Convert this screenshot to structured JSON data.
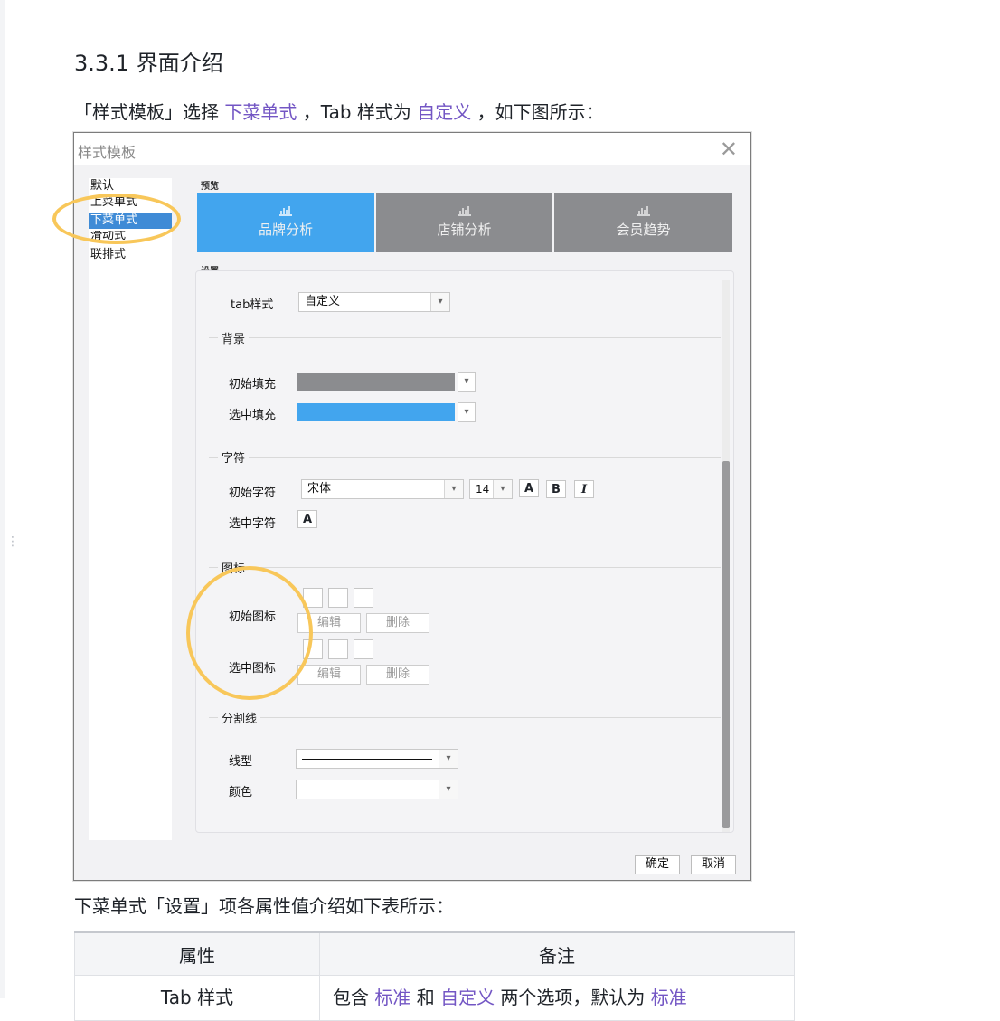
{
  "heading": "3.3.1 界面介绍",
  "intro": {
    "prefix": "「样式模板」选择 ",
    "link1": "下菜单式",
    "middle": " ，Tab 样式为 ",
    "link2": "自定义",
    "suffix": " ，如下图所示："
  },
  "dialog": {
    "title": "样式模板",
    "style_list": [
      "默认",
      "上菜单式",
      "下菜单式",
      "滑动式",
      "联排式"
    ],
    "selected_style": "下菜单式",
    "preview_label": "预览",
    "preview_tabs": [
      {
        "label": "品牌分析",
        "active": true
      },
      {
        "label": "店铺分析",
        "active": false
      },
      {
        "label": "会员趋势",
        "active": false
      }
    ],
    "settings_label": "设置",
    "tab_style": {
      "label": "tab样式",
      "value": "自定义"
    },
    "background": {
      "title": "背景",
      "initial_fill": {
        "label": "初始填充",
        "color": "#8b8c8f"
      },
      "selected_fill": {
        "label": "选中填充",
        "color": "#42a5ee"
      }
    },
    "chars": {
      "title": "字符",
      "initial": {
        "label": "初始字符",
        "font": "宋体",
        "size": "14",
        "btn_a": "A",
        "btn_b": "B",
        "btn_i": "I"
      },
      "selected": {
        "label": "选中字符",
        "btn_a": "A"
      }
    },
    "icons": {
      "title": "图标",
      "initial": {
        "label": "初始图标",
        "edit": "编辑",
        "delete": "删除"
      },
      "selected": {
        "label": "选中图标",
        "edit": "编辑",
        "delete": "删除"
      }
    },
    "divider": {
      "title": "分割线",
      "line_type_label": "线型",
      "color_label": "颜色"
    },
    "ok": "确定",
    "cancel": "取消"
  },
  "table_intro": "下菜单式「设置」项各属性值介绍如下表所示：",
  "table": {
    "headers": [
      "属性",
      "备注"
    ],
    "row1": {
      "attr": "Tab 样式",
      "note_prefix": "包含 ",
      "note_link1": "标准",
      "note_mid1": " 和 ",
      "note_link2": "自定义",
      "note_mid2": " 两个选项，默认为 ",
      "note_link3": "标准"
    }
  },
  "colors": {
    "accent_link": "#7356c4",
    "highlight": "#f8c75a"
  }
}
